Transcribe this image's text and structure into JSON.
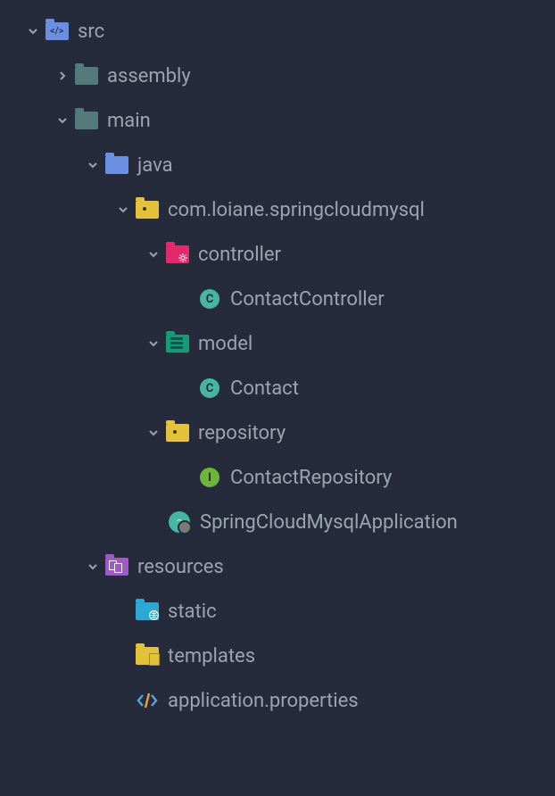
{
  "tree": {
    "src": "src",
    "assembly": "assembly",
    "main": "main",
    "java": "java",
    "package": "com.loiane.springcloudmysql",
    "controller": "controller",
    "contactController": "ContactController",
    "model": "model",
    "contact": "Contact",
    "repository": "repository",
    "contactRepository": "ContactRepository",
    "application": "SpringCloudMysqlApplication",
    "resources": "resources",
    "static": "static",
    "templates": "templates",
    "properties": "application.properties"
  }
}
